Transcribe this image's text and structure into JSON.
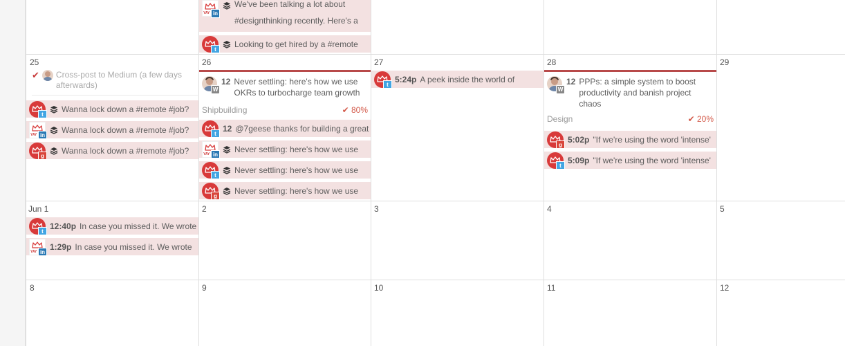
{
  "colors": {
    "accent": "#b84a4a",
    "post_bg": "#f3e1e1",
    "twitter": "#42a5e3",
    "linkedin": "#2a79b4",
    "google_plus": "#d8453a"
  },
  "weeks": {
    "top": {
      "posts": [
        {
          "text": "We've been talking a lot about #designthinking recently. Here's a",
          "network": "linkedin",
          "icon": "stack-icon"
        },
        {
          "text": "Looking to get hired by a #remote",
          "network": "twitter",
          "icon": "stack-icon"
        }
      ]
    },
    "w1": {
      "days": [
        "25",
        "26",
        "27",
        "28",
        "29"
      ],
      "day25": {
        "draft": "Cross-post to Medium (a few days afterwards)",
        "posts": [
          {
            "text": "Wanna lock down a #remote #job?",
            "network": "twitter"
          },
          {
            "text": "Wanna lock down a #remote #job?",
            "network": "linkedin"
          },
          {
            "text": "Wanna lock down a #remote #job?",
            "network": "google-plus"
          }
        ]
      },
      "day26": {
        "blog": {
          "count": "12",
          "title": "Never settling: here's how we use OKRs to turbocharge team growth",
          "category": "Shipbuilding",
          "percent": "80%",
          "progress": 0.8
        },
        "posts": [
          {
            "count": "12",
            "text": "@7geese thanks for building a great",
            "network": "twitter"
          },
          {
            "text": "Never settling: here's how we use",
            "network": "linkedin"
          },
          {
            "text": "Never settling: here's how we use",
            "network": "twitter"
          },
          {
            "text": "Never settling: here's how we use",
            "network": "google-plus"
          }
        ]
      },
      "day27": {
        "posts": [
          {
            "time": "5:24p",
            "text": "A peek inside the world of",
            "network": "twitter"
          }
        ]
      },
      "day28": {
        "blog": {
          "count": "12",
          "title": "PPPs: a simple system to boost productivity and banish project chaos",
          "category": "Design",
          "percent": "20%",
          "progress": 0.2
        },
        "posts": [
          {
            "time": "5:02p",
            "text": "\"If we're using the word 'intense'",
            "network": "google-plus"
          },
          {
            "time": "5:09p",
            "text": "\"If we're using the word 'intense'",
            "network": "twitter"
          }
        ]
      }
    },
    "w2": {
      "days": [
        "Jun 1",
        "2",
        "3",
        "4",
        "5"
      ],
      "day1": {
        "posts": [
          {
            "time": "12:40p",
            "text": "In case you missed it. We wrote",
            "network": "twitter"
          },
          {
            "time": "1:29p",
            "text": "In case you missed it. We wrote",
            "network": "linkedin"
          }
        ]
      }
    },
    "w3": {
      "days": [
        "8",
        "9",
        "10",
        "11",
        "12"
      ]
    }
  }
}
